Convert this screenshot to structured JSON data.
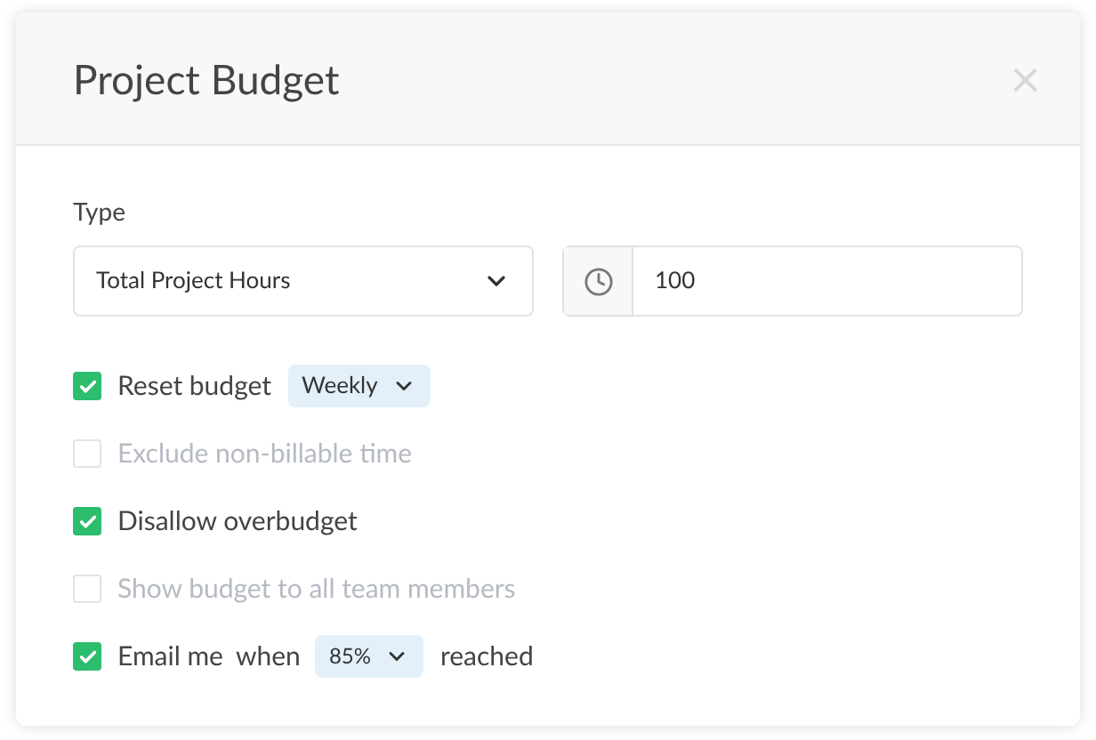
{
  "dialog": {
    "title": "Project Budget",
    "close": "×"
  },
  "type": {
    "label": "Type",
    "select": "Total Project Hours",
    "amount": "100"
  },
  "options": [
    {
      "kind": "dropdown",
      "label": "Reset budget",
      "checked": true,
      "dropdown": "Weekly"
    },
    {
      "kind": "plain",
      "label": "Exclude non-billable time",
      "checked": false
    },
    {
      "kind": "plain",
      "label": "Disallow overbudget",
      "checked": true
    },
    {
      "kind": "plain",
      "label": "Show budget to all team members",
      "checked": false
    },
    {
      "kind": "threshold",
      "label": "Email me",
      "connector": "when",
      "dropdown": "85%",
      "suffix": "reached",
      "checked": true
    }
  ]
}
